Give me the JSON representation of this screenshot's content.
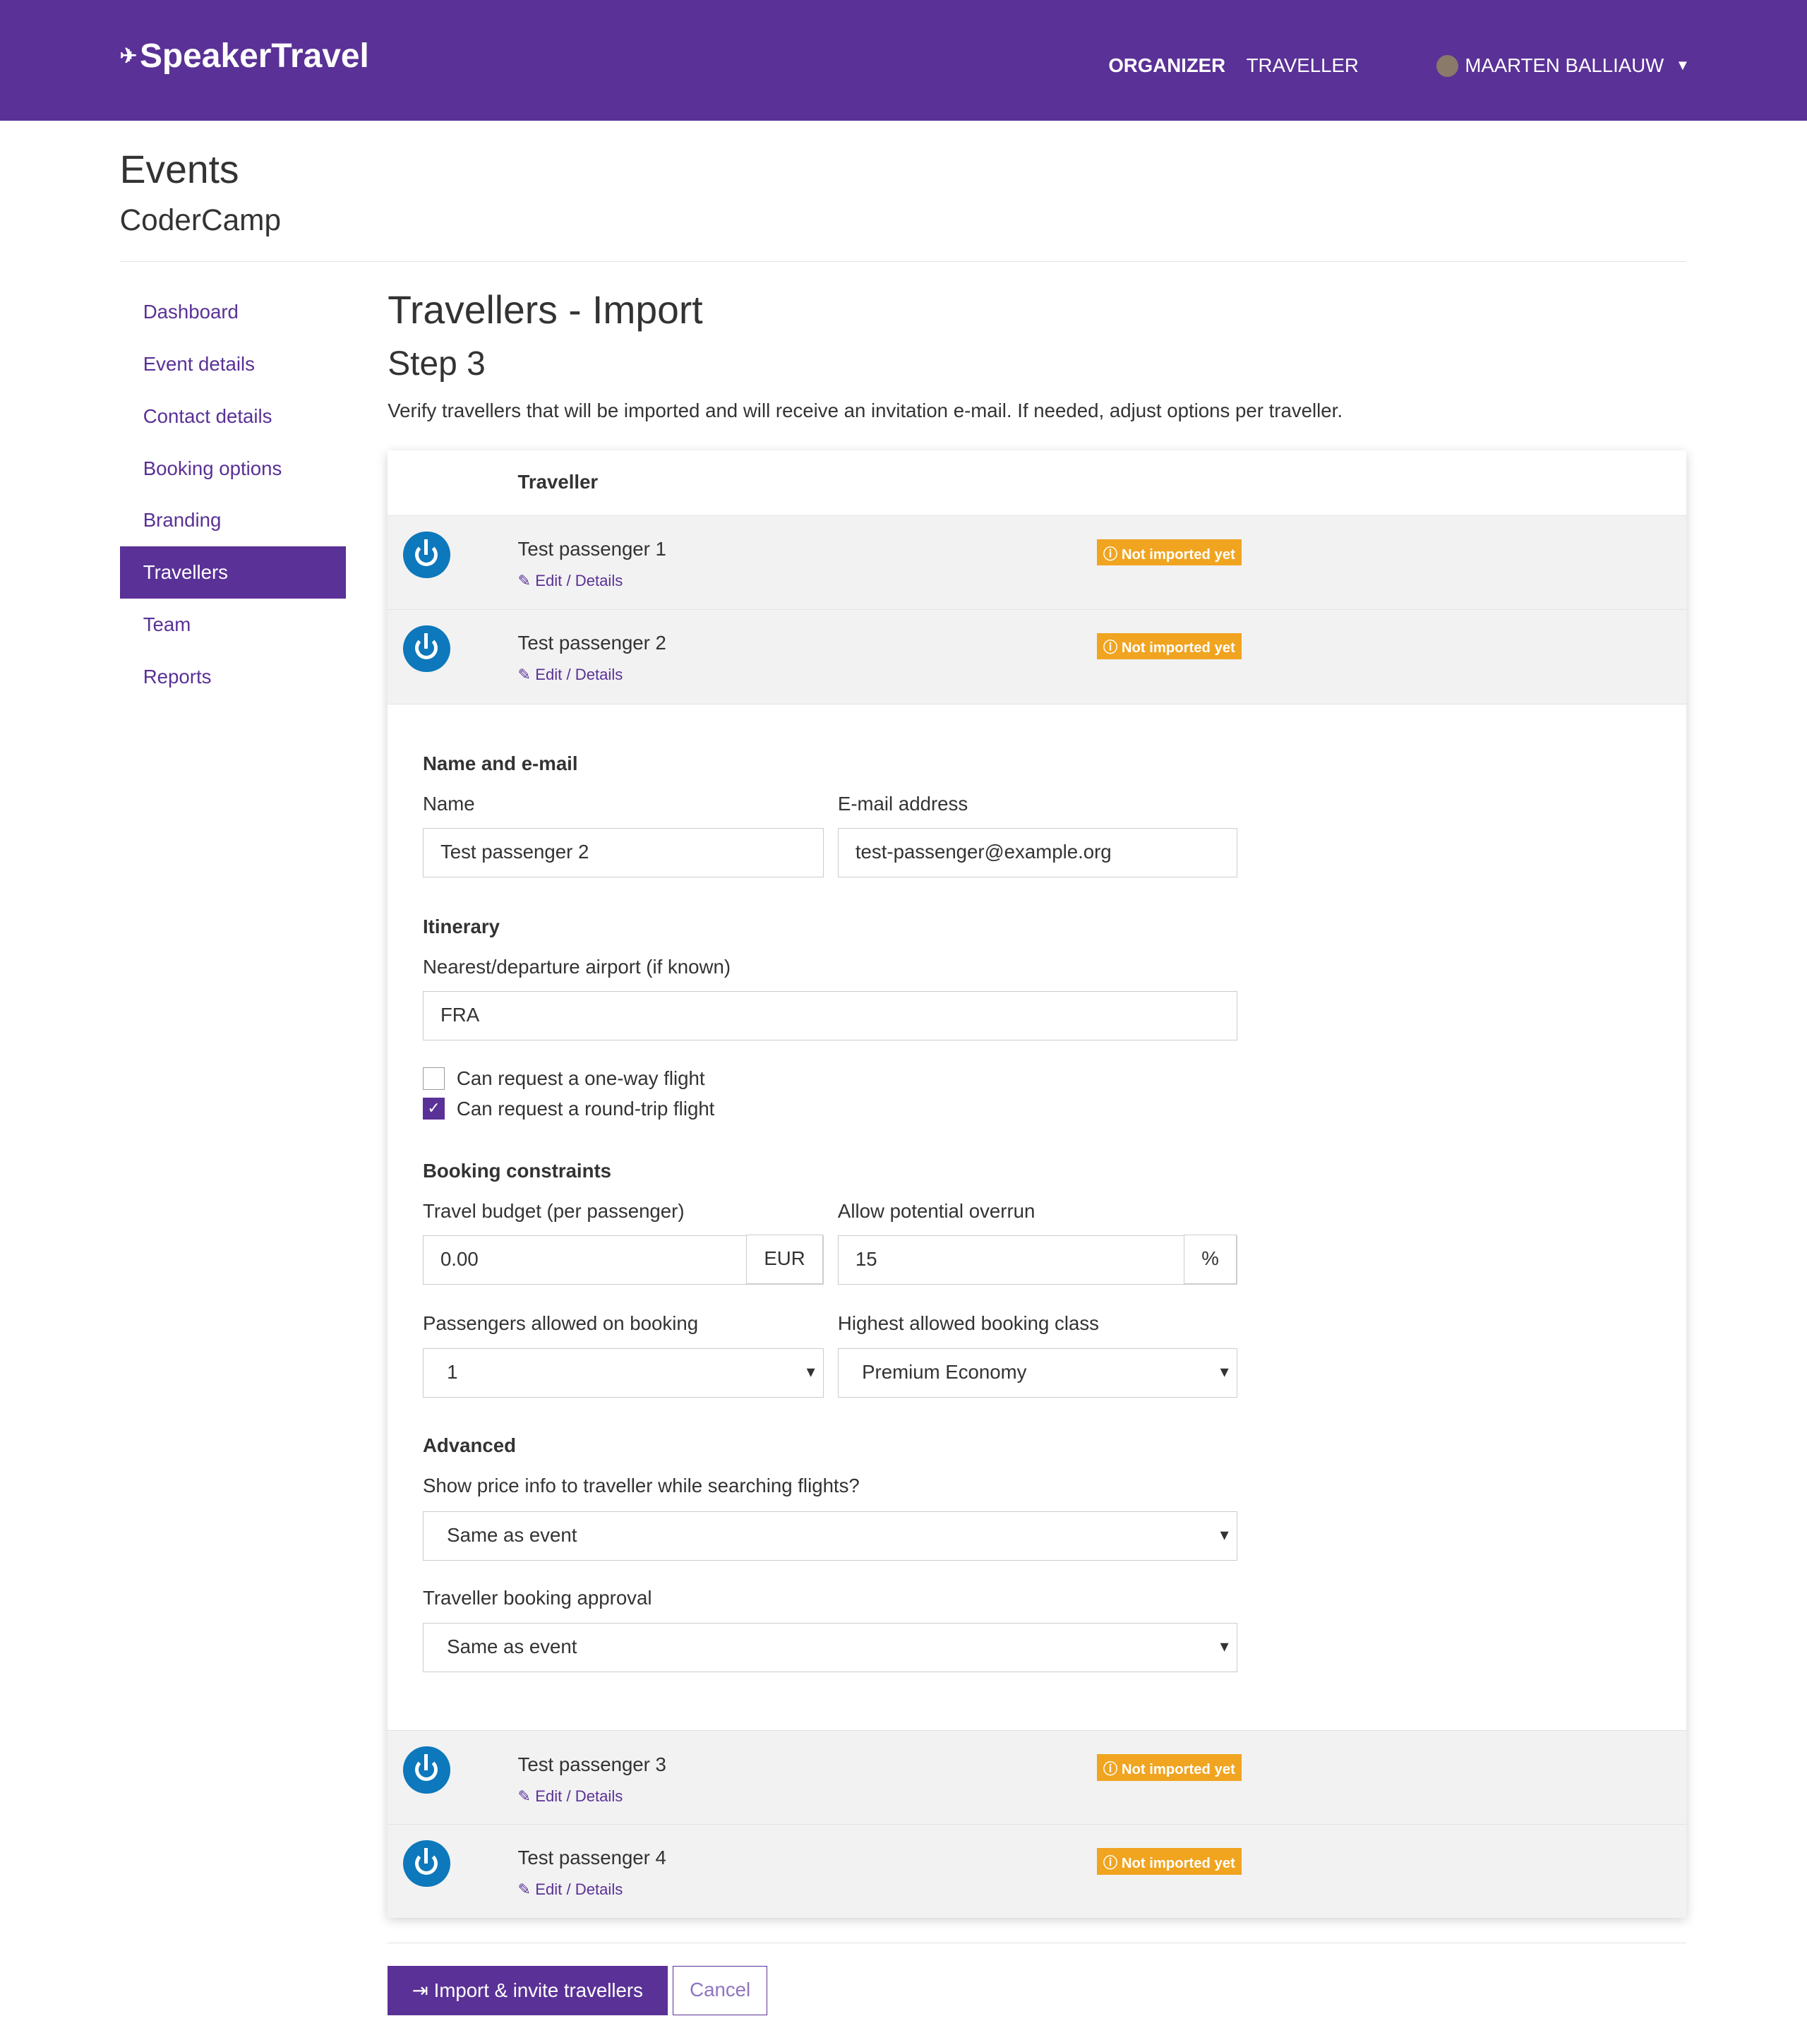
{
  "header": {
    "logo": "SpeakerTravel",
    "nav": [
      "ORGANIZER",
      "TRAVELLER"
    ],
    "user": "MAARTEN BALLIAUW"
  },
  "page": {
    "title": "Events",
    "subtitle": "CoderCamp"
  },
  "sidebar": {
    "items": [
      "Dashboard",
      "Event details",
      "Contact details",
      "Booking options",
      "Branding",
      "Travellers",
      "Team",
      "Reports"
    ],
    "active": "Travellers"
  },
  "main": {
    "title": "Travellers - Import",
    "step": "Step 3",
    "description": "Verify travellers that will be imported and will receive an invitation e-mail. If needed, adjust options per traveller.",
    "column": "Traveller"
  },
  "travellers": [
    {
      "name": "Test passenger 1",
      "edit": "Edit / Details",
      "status": "Not imported yet"
    },
    {
      "name": "Test passenger 2",
      "edit": "Edit / Details",
      "status": "Not imported yet"
    },
    {
      "name": "Test passenger 3",
      "edit": "Edit / Details",
      "status": "Not imported yet"
    },
    {
      "name": "Test passenger 4",
      "edit": "Edit / Details",
      "status": "Not imported yet"
    }
  ],
  "form": {
    "name_section": "Name and e-mail",
    "name_label": "Name",
    "name_value": "Test passenger 2",
    "email_label": "E-mail address",
    "email_value": "test-passenger@example.org",
    "itinerary_section": "Itinerary",
    "airport_label": "Nearest/departure airport (if known)",
    "airport_value": "FRA",
    "oneway_label": "Can request a one-way flight",
    "oneway_checked": false,
    "roundtrip_label": "Can request a round-trip flight",
    "roundtrip_checked": true,
    "constraints_section": "Booking constraints",
    "budget_label": "Travel budget (per passenger)",
    "budget_value": "0.00",
    "budget_currency": "EUR",
    "overrun_label": "Allow potential overrun",
    "overrun_value": "15",
    "overrun_unit": "%",
    "passengers_label": "Passengers allowed on booking",
    "passengers_value": "1",
    "class_label": "Highest allowed booking class",
    "class_value": "Premium Economy",
    "advanced_section": "Advanced",
    "price_label": "Show price info to traveller while searching flights?",
    "price_value": "Same as event",
    "approval_label": "Traveller booking approval",
    "approval_value": "Same as event"
  },
  "actions": {
    "import": "Import & invite travellers",
    "cancel": "Cancel"
  },
  "colors": {
    "brand": "#5a3196",
    "badge": "#f0a420",
    "avatar": "#0d78bc"
  }
}
